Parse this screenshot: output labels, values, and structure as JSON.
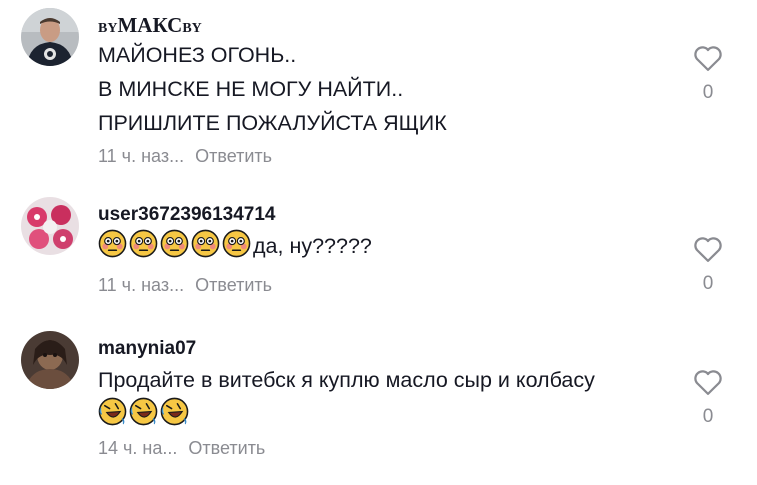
{
  "comments": [
    {
      "username_prefix": "BY",
      "username_main": "МАКС",
      "username_suffix": "BY",
      "lines": [
        "МАЙОНЕЗ ОГОНЬ..",
        "В МИНСКЕ НЕ МОГУ НАЙТИ..",
        "ПРИШЛИТЕ ПОЖАЛУЙСТА ЯЩИК"
      ],
      "time": "11 ч. наз...",
      "reply": "Ответить",
      "likes": "0",
      "avatar_icon": "user-avatar-man-dark-shirt"
    },
    {
      "username": "user3672396134714",
      "emoji_count": 5,
      "emoji_icon": "flushed-face-emoji",
      "text_after_emoji": "да, ну?????",
      "time": "11 ч. наз...",
      "reply": "Ответить",
      "likes": "0",
      "avatar_icon": "user-avatar-pink-cupcakes"
    },
    {
      "username": "manynia07",
      "lines": [
        "Продайте в витебск я куплю масло сыр и колбасу"
      ],
      "emoji_count": 3,
      "emoji_icon": "rolling-on-floor-laughing-emoji",
      "time": "14 ч. на...",
      "reply": "Ответить",
      "likes": "0",
      "avatar_icon": "user-avatar-dark-figure"
    }
  ],
  "colors": {
    "text": "#161823",
    "muted": "#8a8b91",
    "emoji": "#f6c744"
  }
}
